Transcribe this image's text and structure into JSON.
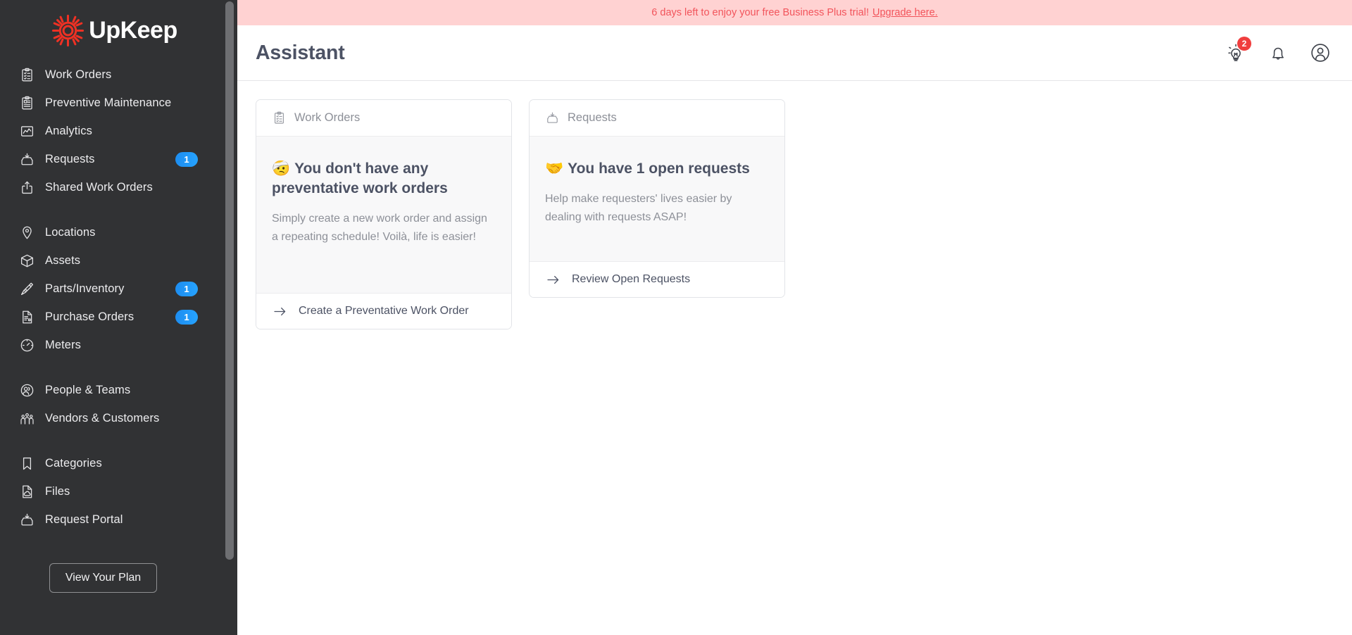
{
  "brand": {
    "name": "UpKeep",
    "logo_icon": "gear-icon",
    "accent_red": "#ee3124",
    "sidebar_bg": "#313234",
    "badge_blue": "#1d8df0",
    "title_color": "#4c5264"
  },
  "sidebar": {
    "groups": [
      {
        "items": [
          {
            "label": "Work Orders",
            "icon": "clipboard-check-icon",
            "badge": null
          },
          {
            "label": "Preventive Maintenance",
            "icon": "clipboard-list-icon",
            "badge": null
          },
          {
            "label": "Analytics",
            "icon": "chart-line-icon",
            "badge": null
          },
          {
            "label": "Requests",
            "icon": "inbox-in-icon",
            "badge": "1"
          },
          {
            "label": "Shared Work Orders",
            "icon": "share-upload-icon",
            "badge": null
          }
        ]
      },
      {
        "items": [
          {
            "label": "Locations",
            "icon": "map-pin-icon",
            "badge": null
          },
          {
            "label": "Assets",
            "icon": "cube-icon",
            "badge": null
          },
          {
            "label": "Parts/Inventory",
            "icon": "screw-icon",
            "badge": "1"
          },
          {
            "label": "Purchase Orders",
            "icon": "document-invoice-icon",
            "badge": "1"
          },
          {
            "label": "Meters",
            "icon": "gauge-icon",
            "badge": null
          }
        ]
      },
      {
        "items": [
          {
            "label": "People & Teams",
            "icon": "people-icon",
            "badge": null
          },
          {
            "label": "Vendors & Customers",
            "icon": "group-people-icon",
            "badge": null
          }
        ]
      },
      {
        "items": [
          {
            "label": "Categories",
            "icon": "bookmark-icon",
            "badge": null
          },
          {
            "label": "Files",
            "icon": "file-cloud-icon",
            "badge": null
          },
          {
            "label": "Request Portal",
            "icon": "inbox-in-icon",
            "badge": null
          }
        ]
      }
    ],
    "plan_button": "View Your Plan"
  },
  "banner": {
    "message": "6 days left to enjoy your free Business Plus trial!",
    "link_text": "Upgrade here.",
    "bg": "#ffd2d2",
    "text_color": "#f2545b"
  },
  "header": {
    "title": "Assistant",
    "actions": [
      {
        "name": "lightbulb-icon",
        "badge": "2",
        "badge_color": "#f03e3e"
      },
      {
        "name": "bell-icon",
        "badge": null
      },
      {
        "name": "user-avatar-icon",
        "badge": null
      }
    ]
  },
  "cards": [
    {
      "head_title": "Work Orders",
      "head_icon": "clipboard-check-icon",
      "emoji": "🤕",
      "heading": "You don't have any preventative work orders",
      "body_text": "Simply create a new work order and assign a repeating schedule! Voilà, life is easier!",
      "footer_label": "Create a Preventative Work Order",
      "footer_icon": "arrow-right-icon"
    },
    {
      "head_title": "Requests",
      "head_icon": "inbox-in-icon",
      "emoji": "🤝",
      "heading": "You have 1 open requests",
      "body_text": "Help make requesters' lives easier by dealing with requests ASAP!",
      "footer_label": "Review Open Requests",
      "footer_icon": "arrow-right-icon"
    }
  ]
}
